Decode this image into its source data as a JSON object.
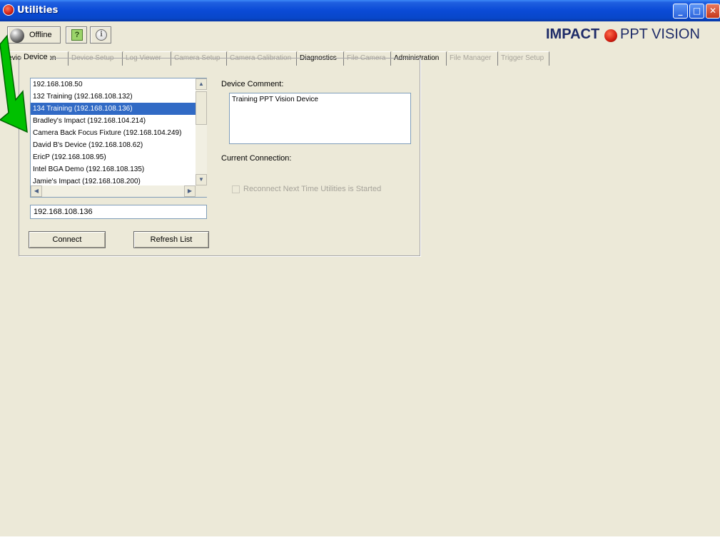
{
  "window": {
    "title": "Utilities",
    "controls": {
      "minimize": "_",
      "maximize": "□",
      "close": "✕"
    }
  },
  "toolbar": {
    "status_label": "Offline",
    "help_glyph": "?",
    "info_glyph": "i"
  },
  "brand": {
    "impact": "IMPACT",
    "ppt": "PPT VISION"
  },
  "tabs": [
    {
      "label": "Device Selection",
      "enabled": true,
      "active": true
    },
    {
      "label": "Device Setup",
      "enabled": false
    },
    {
      "label": "Log Viewer",
      "enabled": false
    },
    {
      "label": "Camera Setup",
      "enabled": false
    },
    {
      "label": "Camera Calibration",
      "enabled": false
    },
    {
      "label": "Diagnostics",
      "enabled": true
    },
    {
      "label": "File Camera",
      "enabled": false
    },
    {
      "label": "Administration",
      "enabled": true
    },
    {
      "label": "File Manager",
      "enabled": false
    },
    {
      "label": "Trigger Setup",
      "enabled": false
    }
  ],
  "device": {
    "group_label": "Device",
    "list": [
      "192.168.108.50",
      "132 Training   (192.168.108.132)",
      "134 Training   (192.168.108.136)",
      "Bradley's Impact   (192.168.104.214)",
      "Camera Back Focus Fixture   (192.168.104.249)",
      "David B's Device   (192.168.108.62)",
      "EricP   (192.168.108.95)",
      "Intel BGA Demo   (192.168.108.135)",
      "Jamie's Impact   (192.168.108.200)"
    ],
    "selected_index": 2,
    "address_value": "192.168.108.136",
    "connect_label": "Connect",
    "refresh_label": "Refresh List",
    "comment_label": "Device Comment:",
    "comment_value": "Training PPT Vision Device",
    "connection_label": "Current Connection:",
    "reconnect_label": "Reconnect Next Time Utilities is Started",
    "reconnect_checked": false
  },
  "colors": {
    "selection": "#316ac5",
    "window_bg": "#ece9d8",
    "annotation_arrow": "#00c000"
  }
}
